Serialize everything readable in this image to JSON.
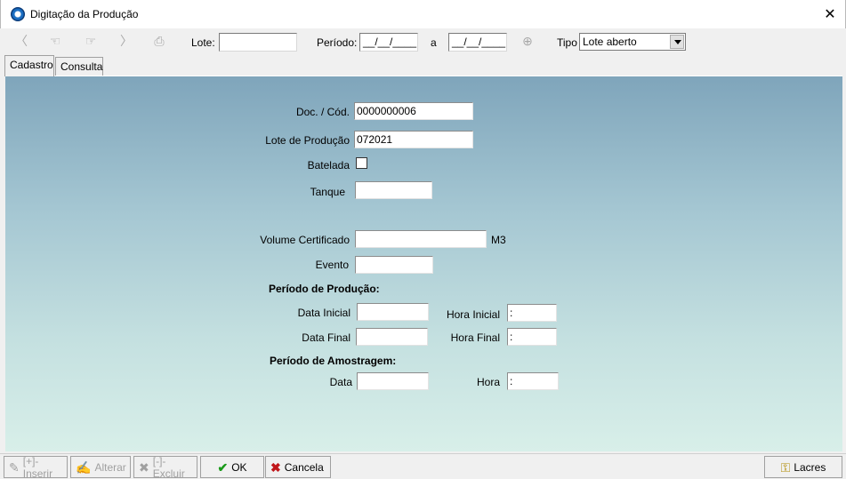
{
  "window": {
    "title": "Digitação da Produção",
    "close_glyph": "✕"
  },
  "toolbar": {
    "icons": {
      "first": "first-record-icon",
      "prev": "previous-record-icon",
      "next": "next-record-icon",
      "last": "last-record-icon",
      "print": "print-icon",
      "search": "zoom-search-icon"
    },
    "lote_label": "Lote:",
    "lote_value": "",
    "periodo_label": "Período:",
    "periodo_start": "__/__/____",
    "periodo_sep": "a",
    "periodo_end": "__/__/____",
    "tipo_label": "Tipo",
    "tipo_value": "Lote aberto"
  },
  "tabs": [
    {
      "label": "Cadastro",
      "active": true
    },
    {
      "label": "Consulta",
      "active": false
    }
  ],
  "form": {
    "doc_cod_label": "Doc. / Cód.",
    "doc_cod_value": "0000000006",
    "lote_producao_label": "Lote de Produção",
    "lote_producao_value": "072021",
    "batelada_label": "Batelada",
    "batelada_checked": false,
    "tanque_label": "Tanque",
    "tanque_value": "",
    "volume_label": "Volume Certificado",
    "volume_value": "",
    "volume_unit": "M3",
    "evento_label": "Evento",
    "evento_value": "",
    "periodo_producao_title": "Período de Produção:",
    "data_inicial_label": "Data Inicial",
    "data_inicial_value": "",
    "hora_inicial_label": "Hora Inicial",
    "hora_inicial_value": " :",
    "data_final_label": "Data Final",
    "data_final_value": "",
    "hora_final_label": "Hora Final",
    "hora_final_value": " :",
    "periodo_amostragem_title": "Período de Amostragem:",
    "data_label": "Data",
    "data_value": "",
    "hora_label": "Hora",
    "hora_value": " :"
  },
  "buttons": {
    "inserir": "[+]-Inserir",
    "alterar": "Alterar",
    "excluir": "[-]-Excluir",
    "ok": "OK",
    "cancela": "Cancela",
    "lacres": "Lacres"
  },
  "colors": {
    "ok_check": "#1a9a1a",
    "cancel_x": "#c0161a"
  }
}
